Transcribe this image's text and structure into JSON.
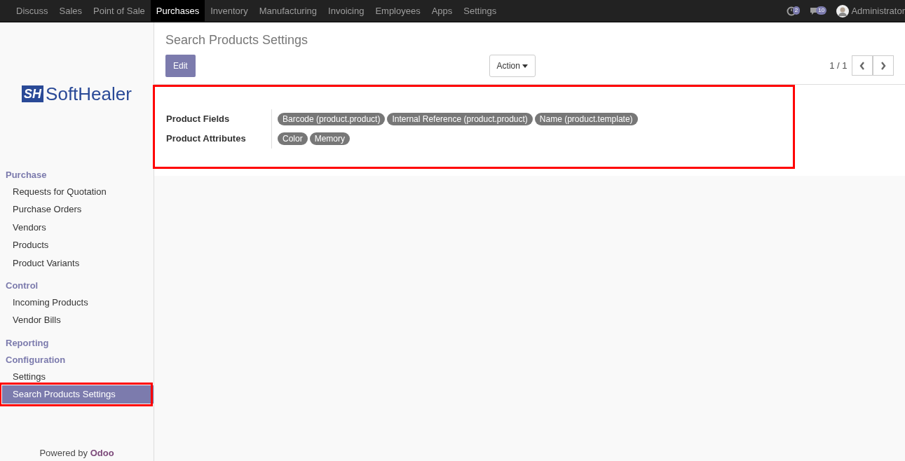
{
  "top_menu": [
    {
      "label": "Discuss",
      "selected": false
    },
    {
      "label": "Sales",
      "selected": false
    },
    {
      "label": "Point of Sale",
      "selected": false
    },
    {
      "label": "Purchases",
      "selected": true
    },
    {
      "label": "Inventory",
      "selected": false
    },
    {
      "label": "Manufacturing",
      "selected": false
    },
    {
      "label": "Invoicing",
      "selected": false
    },
    {
      "label": "Employees",
      "selected": false
    },
    {
      "label": "Apps",
      "selected": false
    },
    {
      "label": "Settings",
      "selected": false
    }
  ],
  "systray": {
    "activity_count": "2",
    "message_count": "10",
    "user": "Administrator"
  },
  "logo": {
    "mark": "SH",
    "text": "SoftHealer"
  },
  "sidebar": [
    {
      "heading": "Purchase",
      "items": [
        {
          "label": "Requests for Quotation",
          "selected": false
        },
        {
          "label": "Purchase Orders",
          "selected": false
        },
        {
          "label": "Vendors",
          "selected": false
        },
        {
          "label": "Products",
          "selected": false
        },
        {
          "label": "Product Variants",
          "selected": false
        }
      ]
    },
    {
      "heading": "Control",
      "items": [
        {
          "label": "Incoming Products",
          "selected": false
        },
        {
          "label": "Vendor Bills",
          "selected": false
        }
      ]
    },
    {
      "heading": "Reporting"
    },
    {
      "heading": "Configuration",
      "items": [
        {
          "label": "Settings",
          "selected": false
        },
        {
          "label": "Search Products Settings",
          "selected": true
        }
      ]
    }
  ],
  "powered_by": {
    "text": "Powered by",
    "brand": "Odoo"
  },
  "page": {
    "title": "Search Products Settings",
    "edit_button": "Edit",
    "action_button": "Action",
    "pager": "1 / 1"
  },
  "form": [
    {
      "label": "Product Fields",
      "tags": [
        "Barcode (product.product)",
        "Internal Reference (product.product)",
        "Name (product.template)"
      ]
    },
    {
      "label": "Product Attributes",
      "tags": [
        "Color",
        "Memory"
      ]
    }
  ]
}
